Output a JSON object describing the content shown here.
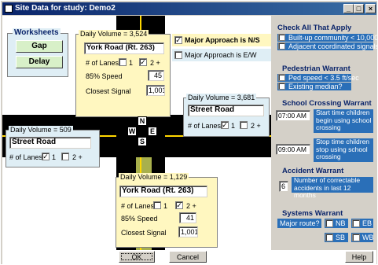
{
  "window": {
    "title": "Site Data for study: Demo2"
  },
  "titlebar_buttons": {
    "minimize": "_",
    "maximize": "□",
    "close": "×"
  },
  "worksheets": {
    "title": "Worksheets",
    "gap": "Gap",
    "delay": "Delay"
  },
  "north_approach": {
    "daily_volume": "Daily Volume = 3,524",
    "road_name": "York Road (Rt. 263)",
    "lanes_label": "# of Lanes",
    "lanes_1": "1",
    "lanes_2": "2 +",
    "speed_label": "85% Speed",
    "speed_value": "45",
    "signal_label": "Closest Signal",
    "signal_value": "1,001"
  },
  "south_approach": {
    "daily_volume": "Daily Volume = 1,129",
    "road_name": "York Road (Rt. 263)",
    "lanes_label": "# of Lanes",
    "lanes_1": "1",
    "lanes_2": "2 +",
    "speed_label": "85% Speed",
    "speed_value": "41",
    "signal_label": "Closest Signal",
    "signal_value": "1,001"
  },
  "east_approach": {
    "daily_volume": "Daily Volume = 3,681",
    "road_name": "Street Road",
    "lanes_label": "# of Lanes",
    "lanes_1": "1",
    "lanes_2": "2 +"
  },
  "west_approach": {
    "daily_volume": "Daily Volume = 509",
    "road_name": "Street Road",
    "lanes_label": "# of Lanes",
    "lanes_1": "1",
    "lanes_2": "2 +"
  },
  "major_approach": {
    "ns": "Major Approach is N/S",
    "ew": "Major Approach is E/W"
  },
  "compass": {
    "n": "N",
    "s": "S",
    "e": "E",
    "w": "W"
  },
  "check_all": {
    "title": "Check All That Apply",
    "built_up": "Built-up community < 10,000",
    "adjacent": "Adjacent coordinated signals"
  },
  "pedestrian": {
    "title": "Pedestrian Warrant",
    "ped_speed": "Ped speed < 3.5 ft/sec",
    "existing_median": "Existing median?"
  },
  "school": {
    "title": "School Crossing Warrant",
    "start_time": "07:00 AM",
    "start_label": "Start time children begin using school crossing",
    "stop_time": "09:00 AM",
    "stop_label": "Stop time children stop using school crossing"
  },
  "accident": {
    "title": "Accident Warrant",
    "count": "6",
    "label": "Number of correctable accidents in last 12 months"
  },
  "systems": {
    "title": "Systems Warrant",
    "major_route": "Major route?",
    "nb": "NB",
    "eb": "EB",
    "sb": "SB",
    "wb": "WB"
  },
  "footer": {
    "ok": "OK",
    "cancel": "Cancel",
    "help": "Help"
  }
}
